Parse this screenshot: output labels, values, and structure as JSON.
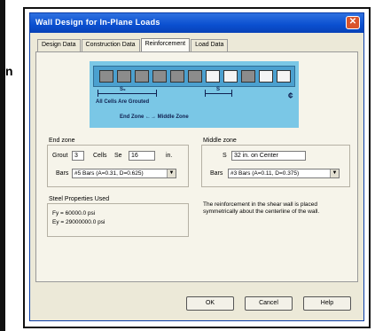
{
  "window": {
    "title": "Wall Design for In-Plane Loads",
    "close_glyph": "✕"
  },
  "clipped_text": "n",
  "tabs": [
    {
      "label": "Design Data"
    },
    {
      "label": "Construction Data"
    },
    {
      "label": "Reinforcement"
    },
    {
      "label": "Load Data"
    }
  ],
  "active_tab": "Reinforcement",
  "figure": {
    "s_label": "S₉",
    "s2_label": "S",
    "note1": "All Cells Are Grouted",
    "note2": "End Zone ←→ Middle Zone",
    "centerline": "¢"
  },
  "end_zone": {
    "title": "End zone",
    "grout_label": "Grout",
    "grout_value": "3",
    "cells_label": "Cells",
    "se_label": "Se",
    "se_value": "16",
    "unit": "in.",
    "bars_label": "Bars",
    "bars_value": "#5 Bars (A=0.31, D=0.625)"
  },
  "middle_zone": {
    "title": "Middle zone",
    "s_label": "S",
    "s_value": "32 in. on Center",
    "bars_label": "Bars",
    "bars_value": "#3 Bars (A=0.11, D=0.375)"
  },
  "steel": {
    "title": "Steel Properties Used",
    "fy": "Fy = 60000.0 psi",
    "ey": "Ey = 29000000.0 psi"
  },
  "note": "The reinforcement in the shear wall is placed symmetrically about the centerline of the wall.",
  "buttons": {
    "ok": "OK",
    "cancel": "Cancel",
    "help": "Help"
  },
  "colors": {
    "titlebar": "#0a4fd0",
    "figure_bg": "#7ac7e6",
    "dialog_bg": "#ece9d8"
  }
}
